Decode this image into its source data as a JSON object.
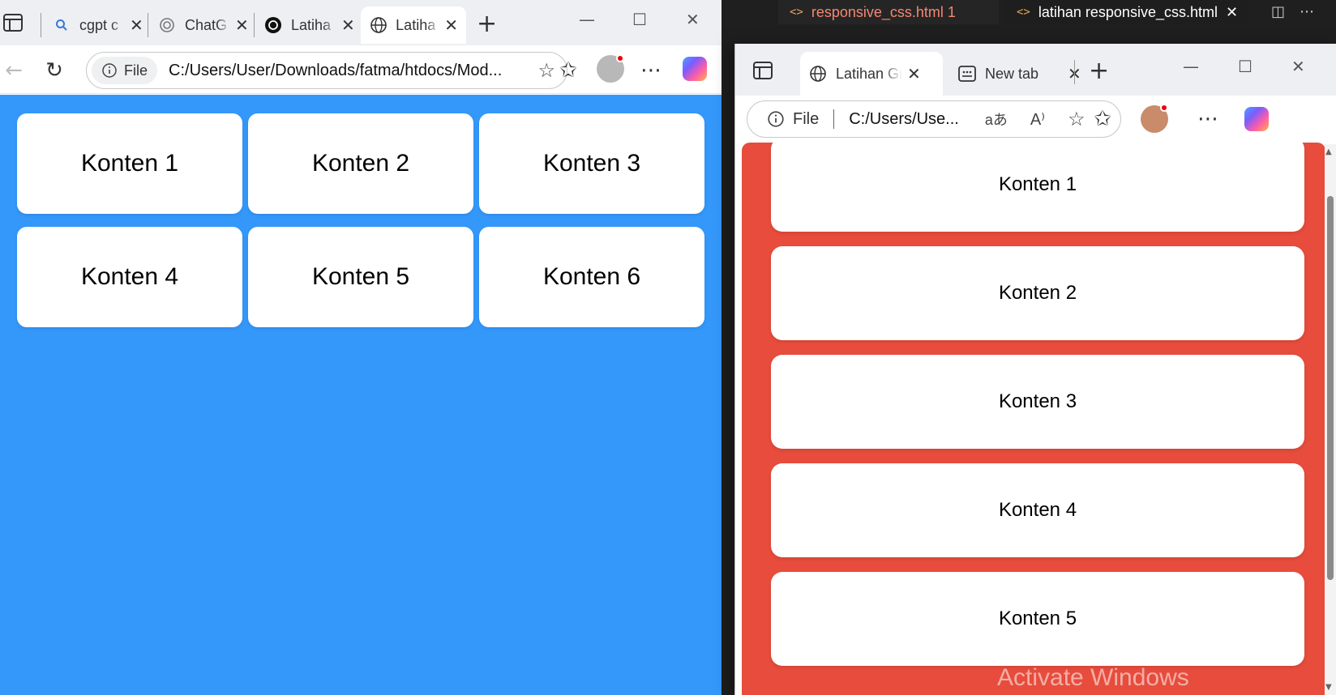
{
  "vscode": {
    "tabs": [
      {
        "label": "responsive_css.html 1",
        "icon": "<>"
      },
      {
        "label": "latihan responsive_css.html",
        "icon": "<>"
      }
    ]
  },
  "window_left": {
    "tabs": [
      {
        "label": "cgpt c",
        "icon": "search-icon"
      },
      {
        "label": "ChatG",
        "icon": "chatgpt-icon"
      },
      {
        "label": "Latiha",
        "icon": "chatgpt-icon"
      },
      {
        "label": "Latiha",
        "icon": "globe-icon"
      }
    ],
    "address": {
      "scheme_label": "File",
      "url": "C:/Users/User/Downloads/fatma/htdocs/Mod..."
    },
    "page": {
      "background": "#3498fb",
      "cards": [
        "Konten 1",
        "Konten 2",
        "Konten 3",
        "Konten 4",
        "Konten 5",
        "Konten 6"
      ]
    }
  },
  "window_right": {
    "tabs": [
      {
        "label": "Latihan Gr",
        "icon": "globe-icon"
      },
      {
        "label": "New tab",
        "icon": "newtab-icon"
      }
    ],
    "address": {
      "scheme_label": "File",
      "url": "C:/Users/Use..."
    },
    "page": {
      "background": "#e74c3c",
      "cards": [
        "Konten 1",
        "Konten 2",
        "Konten 3",
        "Konten 4",
        "Konten 5"
      ]
    }
  },
  "watermark": "Activate Windows"
}
